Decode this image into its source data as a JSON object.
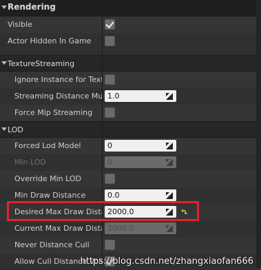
{
  "panel": {
    "rendering": {
      "title": "Rendering",
      "rows": [
        {
          "label": "Visible",
          "checked": true
        },
        {
          "label": "Actor Hidden In Game",
          "checked": false
        }
      ]
    },
    "texture_streaming": {
      "title": "TextureStreaming",
      "rows": [
        {
          "label": "Ignore Instance for Textu",
          "type": "checkbox",
          "checked": false
        },
        {
          "label": "Streaming Distance Multi",
          "type": "number",
          "value": "1.0"
        },
        {
          "label": "Force Mip Streaming",
          "type": "checkbox",
          "checked": false
        }
      ]
    },
    "lod": {
      "title": "LOD",
      "rows": [
        {
          "label": "Forced Lod Model",
          "type": "number",
          "value": "0"
        },
        {
          "label": "Min LOD",
          "type": "number",
          "value": "0",
          "disabled": true
        },
        {
          "label": "Override Min LOD",
          "type": "checkbox",
          "checked": false
        },
        {
          "label": "Min Draw Distance",
          "type": "number",
          "value": "0.0"
        },
        {
          "label": "Desired Max Draw Distan",
          "type": "number",
          "value": "2000.0",
          "has_reset": true
        },
        {
          "label": "Current Max Draw Distanc",
          "type": "number",
          "value": "2000.0",
          "disabled": true
        },
        {
          "label": "Never Distance Cull",
          "type": "checkbox",
          "checked": false
        },
        {
          "label": "Allow Cull Distance Volun",
          "type": "checkbox",
          "checked": true
        }
      ]
    }
  },
  "colors": {
    "highlight": "#e3232a",
    "panel_bg": "#2f2f2f",
    "field_bg": "#f0f0f0"
  },
  "watermark": "https://blog.csdn.net/zhangxiaofan666"
}
